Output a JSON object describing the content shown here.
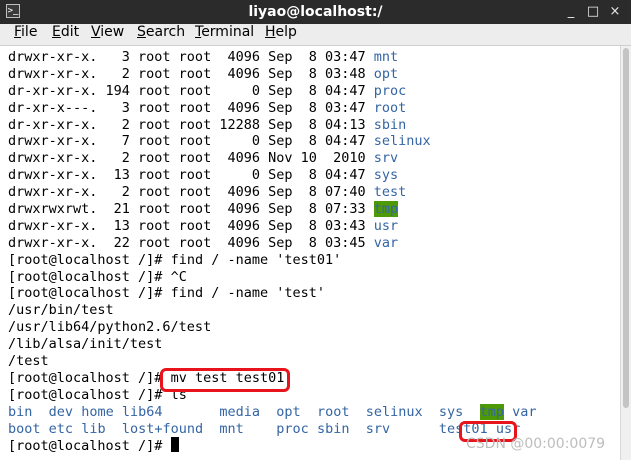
{
  "window": {
    "title": "liyao@localhost:/",
    "icon": "terminal-icon",
    "buttons": {
      "minimize": "_",
      "maximize": "□",
      "close": "×"
    }
  },
  "menu": [
    "File",
    "Edit",
    "View",
    "Search",
    "Terminal",
    "Help"
  ],
  "colors": {
    "dir_blue": "#3465a4",
    "sticky_dir_bg": "#4e9a06",
    "annotation": "#e8141b"
  },
  "listing": [
    {
      "perm": "drwxr-xr-x.",
      "links": "3",
      "user": "root",
      "group": "root",
      "size": "4096",
      "month": "Sep",
      "day": "8",
      "time": "03:47",
      "name": "mnt"
    },
    {
      "perm": "drwxr-xr-x.",
      "links": "2",
      "user": "root",
      "group": "root",
      "size": "4096",
      "month": "Sep",
      "day": "8",
      "time": "03:48",
      "name": "opt"
    },
    {
      "perm": "dr-xr-xr-x.",
      "links": "194",
      "user": "root",
      "group": "root",
      "size": "0",
      "month": "Sep",
      "day": "8",
      "time": "04:47",
      "name": "proc"
    },
    {
      "perm": "dr-xr-x---.",
      "links": "3",
      "user": "root",
      "group": "root",
      "size": "4096",
      "month": "Sep",
      "day": "8",
      "time": "03:47",
      "name": "root"
    },
    {
      "perm": "dr-xr-xr-x.",
      "links": "2",
      "user": "root",
      "group": "root",
      "size": "12288",
      "month": "Sep",
      "day": "8",
      "time": "04:13",
      "name": "sbin"
    },
    {
      "perm": "drwxr-xr-x.",
      "links": "7",
      "user": "root",
      "group": "root",
      "size": "0",
      "month": "Sep",
      "day": "8",
      "time": "04:47",
      "name": "selinux"
    },
    {
      "perm": "drwxr-xr-x.",
      "links": "2",
      "user": "root",
      "group": "root",
      "size": "4096",
      "month": "Nov",
      "day": "10",
      "time": "2010",
      "name": "srv"
    },
    {
      "perm": "drwxr-xr-x.",
      "links": "13",
      "user": "root",
      "group": "root",
      "size": "0",
      "month": "Sep",
      "day": "8",
      "time": "04:47",
      "name": "sys"
    },
    {
      "perm": "drwxr-xr-x.",
      "links": "2",
      "user": "root",
      "group": "root",
      "size": "4096",
      "month": "Sep",
      "day": "8",
      "time": "07:40",
      "name": "test"
    },
    {
      "perm": "drwxrwxrwt.",
      "links": "21",
      "user": "root",
      "group": "root",
      "size": "4096",
      "month": "Sep",
      "day": "8",
      "time": "07:33",
      "name": "tmp",
      "sticky": true
    },
    {
      "perm": "drwxr-xr-x.",
      "links": "13",
      "user": "root",
      "group": "root",
      "size": "4096",
      "month": "Sep",
      "day": "8",
      "time": "03:43",
      "name": "usr"
    },
    {
      "perm": "drwxr-xr-x.",
      "links": "22",
      "user": "root",
      "group": "root",
      "size": "4096",
      "month": "Sep",
      "day": "8",
      "time": "03:45",
      "name": "var"
    }
  ],
  "prompt": "[root@localhost /]# ",
  "session": [
    {
      "type": "cmd",
      "text": "find / -name 'test01'"
    },
    {
      "type": "cmd",
      "text": "^C"
    },
    {
      "type": "cmd",
      "text": "find / -name 'test'"
    },
    {
      "type": "out",
      "text": "/usr/bin/test"
    },
    {
      "type": "out",
      "text": "/usr/lib64/python2.6/test"
    },
    {
      "type": "out",
      "text": "/lib/alsa/init/test"
    },
    {
      "type": "out",
      "text": "/test"
    },
    {
      "type": "cmd",
      "text": "mv test test01"
    },
    {
      "type": "cmd",
      "text": "ls"
    }
  ],
  "ls_output": [
    [
      "bin",
      "dev",
      "home",
      "lib64",
      "media",
      "opt",
      "root",
      "selinux",
      "sys",
      "tmp",
      "var"
    ],
    [
      "boot",
      "etc",
      "lib",
      "lost+found",
      "mnt",
      "proc",
      "sbin",
      "srv",
      "test01",
      "usr",
      ""
    ]
  ],
  "ls_col_widths": [
    5,
    4,
    5,
    12,
    7,
    5,
    6,
    9,
    5,
    4,
    3
  ],
  "watermark": "CSDN @00:00:0079"
}
